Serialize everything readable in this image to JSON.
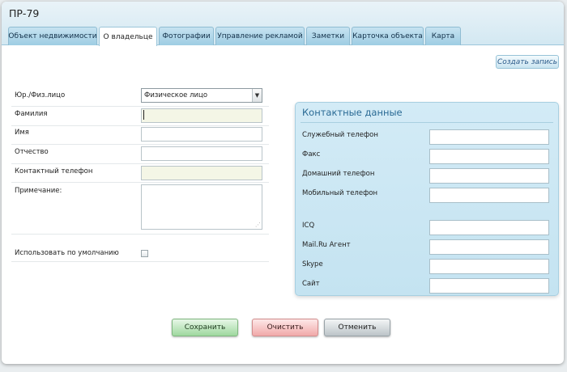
{
  "window": {
    "title": "ПР-79"
  },
  "tabs": [
    {
      "label": "Объект недвижимости"
    },
    {
      "label": "О владельце"
    },
    {
      "label": "Фотографии"
    },
    {
      "label": "Управление рекламой"
    },
    {
      "label": "Заметки"
    },
    {
      "label": "Карточка объекта"
    },
    {
      "label": "Карта"
    }
  ],
  "active_tab": "О владельце",
  "toolbar": {
    "create_label": "Создать запись"
  },
  "owner_form": {
    "legal_type_label": "Юр./Физ.лицо",
    "legal_type_value": "Физическое лицо",
    "surname_label": "Фамилия",
    "name_label": "Имя",
    "patronymic_label": "Отчество",
    "phone_label": "Контактный телефон",
    "note_label": "Примечание:",
    "default_label": "Использовать по умолчанию",
    "default_checked": false
  },
  "contacts": {
    "title": "Контактные данные",
    "work_phone_label": "Служебный телефон",
    "fax_label": "Факс",
    "home_phone_label": "Домашний телефон",
    "mobile_phone_label": "Мобильный телефон",
    "icq_label": "ICQ",
    "mailru_label": "Mail.Ru Агент",
    "skype_label": "Skype",
    "site_label": "Сайт"
  },
  "actions": {
    "save_label": "Сохранить",
    "clear_label": "Очистить",
    "cancel_label": "Отменить"
  },
  "colors": {
    "tab_bg": "#9ecde3",
    "contacts_title": "#2a6a95",
    "save_button": "#9fd89f",
    "clear_button": "#f1a9a9",
    "cancel_button": "#bcc4c8"
  }
}
